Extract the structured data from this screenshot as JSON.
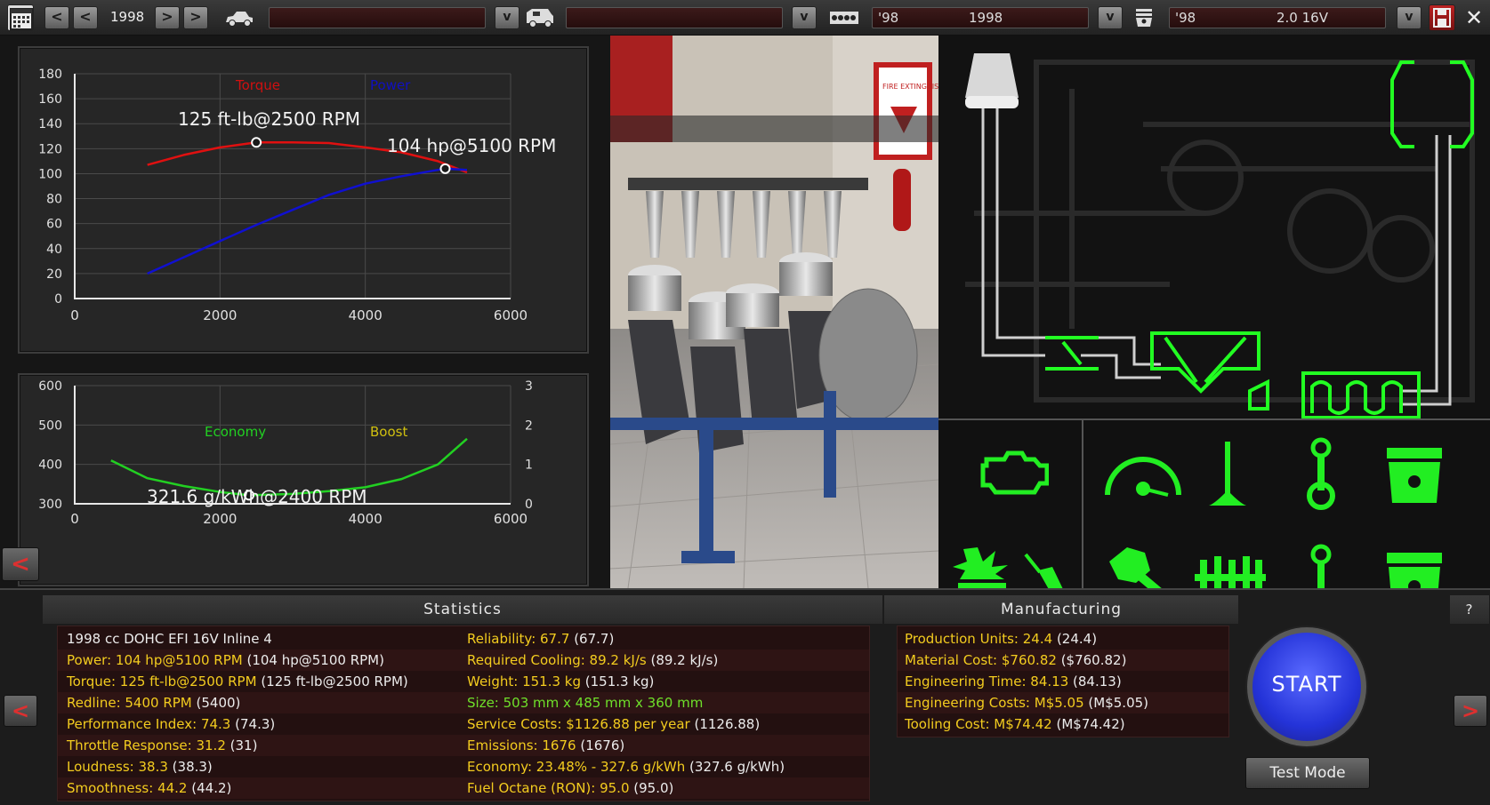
{
  "topbar": {
    "year": "1998",
    "nav_prev": "<",
    "nav_next": ">",
    "dropdown_glyph": "v",
    "family_year": "'98",
    "family_name": "1998",
    "variant_year": "'98",
    "variant_name": "2.0 16V",
    "icons": [
      "calendar-icon",
      "car-icon",
      "van-icon",
      "engine-block-icon",
      "piston-icon",
      "save-icon"
    ]
  },
  "power_chart": {
    "legend_torque": "Torque",
    "legend_power": "Power",
    "peak_torque_label": "125 ft-lb@2500 RPM",
    "peak_power_label": "104 hp@5100 RPM",
    "y_ticks": [
      "0",
      "20",
      "40",
      "60",
      "80",
      "100",
      "120",
      "140",
      "160",
      "180"
    ],
    "x_ticks": [
      "0",
      "2000",
      "4000",
      "6000"
    ]
  },
  "economy_chart": {
    "legend_economy": "Economy",
    "legend_boost": "Boost",
    "peak_label": "321.6 g/kWh@2400 RPM",
    "y_ticks": [
      "300",
      "400",
      "500",
      "600"
    ],
    "y2_ticks": [
      "0",
      "1",
      "2",
      "3"
    ],
    "x_ticks": [
      "0",
      "2000",
      "4000",
      "6000"
    ]
  },
  "chart_data": [
    {
      "type": "line",
      "xlim": [
        0,
        6000
      ],
      "ylim": [
        0,
        180
      ],
      "series": [
        {
          "name": "Torque",
          "color": "#e01010",
          "x": [
            1000,
            1500,
            2000,
            2500,
            3000,
            3500,
            4000,
            4500,
            5000,
            5400
          ],
          "values": [
            107,
            115,
            121,
            125,
            125,
            124.5,
            121,
            117,
            110,
            101
          ]
        },
        {
          "name": "Power",
          "color": "#1010d0",
          "x": [
            1000,
            1500,
            2000,
            2500,
            3000,
            3500,
            4000,
            4500,
            5000,
            5100,
            5400
          ],
          "values": [
            20,
            33,
            46,
            59,
            71,
            83,
            92,
            98,
            103,
            104,
            103
          ]
        }
      ],
      "points": [
        {
          "x": 2500,
          "y": 125
        },
        {
          "x": 5100,
          "y": 104
        }
      ]
    },
    {
      "type": "line",
      "xlim": [
        0,
        6000
      ],
      "ylim": [
        300,
        600
      ],
      "y2lim": [
        0,
        3
      ],
      "series": [
        {
          "name": "Economy",
          "color": "#22d022",
          "x": [
            500,
            1000,
            1500,
            2000,
            2400,
            3000,
            3500,
            4000,
            4500,
            5000,
            5400
          ],
          "values": [
            410,
            365,
            345,
            330,
            321.6,
            325,
            332,
            342,
            363,
            400,
            465
          ]
        }
      ],
      "points": [
        {
          "x": 2400,
          "y": 321.6
        }
      ]
    }
  ],
  "view3d": {
    "sign_text": "FIRE EXTINGUISHER"
  },
  "panel_icons": [
    "engine-icon",
    "gauge-icon",
    "valve-icon",
    "conrod-icon",
    "piston-icon",
    "explosion-icon",
    "spark-plug-icon",
    "wrench-icon",
    "camshaft-icon",
    "conrod-2-icon",
    "piston-2-icon"
  ],
  "statistics": {
    "title": "Statistics",
    "left": [
      {
        "label": "1998 cc DOHC EFI 16V Inline 4",
        "paren": ""
      },
      {
        "label": "Power: 104 hp@5100 RPM",
        "paren": "(104 hp@5100 RPM)"
      },
      {
        "label": "Torque: 125 ft-lb@2500 RPM",
        "paren": "(125 ft-lb@2500 RPM)"
      },
      {
        "label": "Redline: 5400 RPM",
        "paren": "(5400)"
      },
      {
        "label": "Performance Index: 74.3",
        "paren": "(74.3)"
      },
      {
        "label": "Throttle Response: 31.2",
        "paren": "(31)"
      },
      {
        "label": "Loudness: 38.3",
        "paren": "(38.3)"
      },
      {
        "label": "Smoothness: 44.2",
        "paren": "(44.2)"
      }
    ],
    "right": [
      {
        "label": "Reliability: 67.7",
        "paren": "(67.7)"
      },
      {
        "label": "Required Cooling: 89.2 kJ/s",
        "paren": "(89.2 kJ/s)"
      },
      {
        "label": "Weight: 151.3 kg",
        "paren": "(151.3 kg)"
      },
      {
        "label": "Size: 503 mm x 485 mm x 360 mm",
        "paren": ""
      },
      {
        "label": "Service Costs: $1126.88 per year",
        "paren": "(1126.88)"
      },
      {
        "label": "Emissions: 1676",
        "paren": "(1676)"
      },
      {
        "label": "Economy: 23.48% - 327.6 g/kWh",
        "paren": "(327.6 g/kWh)"
      },
      {
        "label": "Fuel Octane (RON): 95.0",
        "paren": "(95.0)"
      }
    ]
  },
  "manufacturing": {
    "title": "Manufacturing",
    "rows": [
      {
        "label": "Production Units: 24.4",
        "paren": "(24.4)"
      },
      {
        "label": "Material Cost: $760.82",
        "paren": "($760.82)"
      },
      {
        "label": "Engineering Time: 84.13",
        "paren": "(84.13)"
      },
      {
        "label": "Engineering Costs: M$5.05",
        "paren": "(M$5.05)"
      },
      {
        "label": "Tooling Cost: M$74.42",
        "paren": "(M$74.42)"
      }
    ]
  },
  "controls": {
    "start_label": "START",
    "test_mode_label": "Test Mode",
    "help_label": "?",
    "back_label": "<",
    "forward_label": ">"
  }
}
